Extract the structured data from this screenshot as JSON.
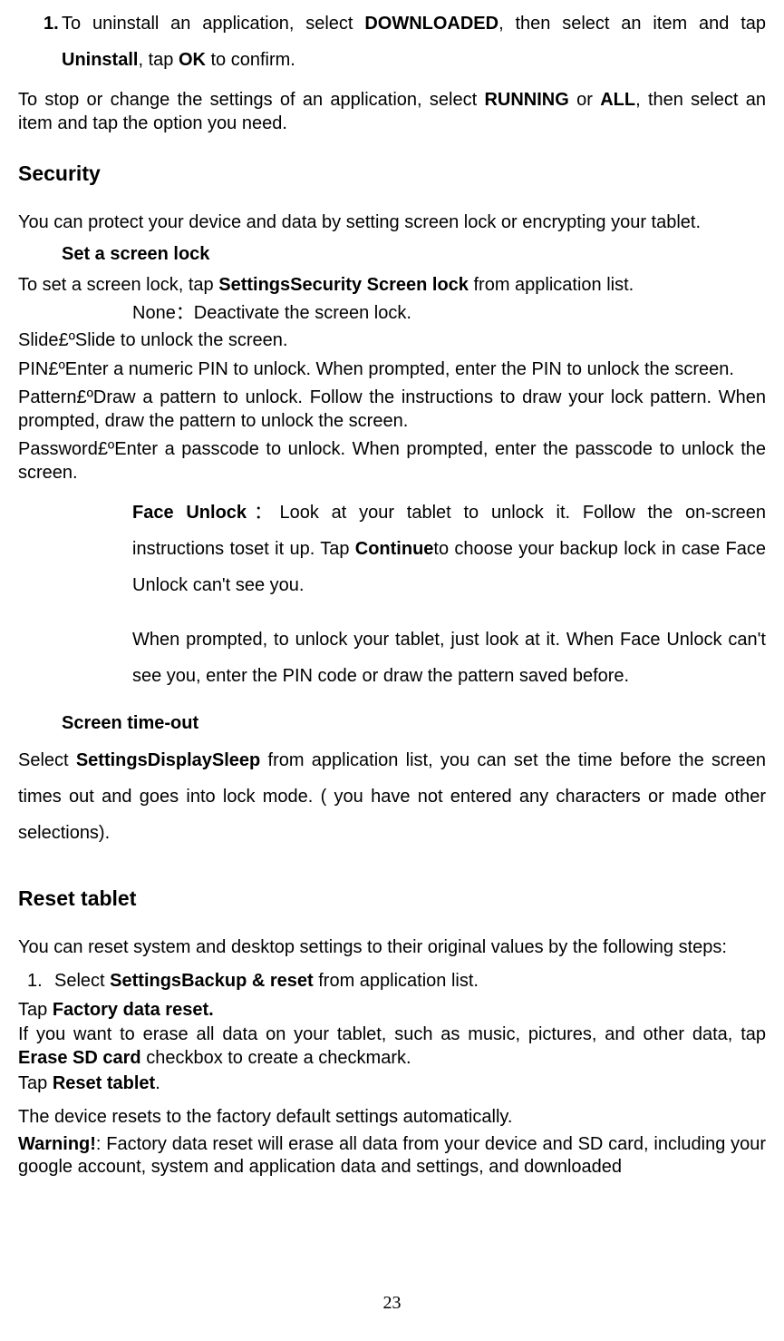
{
  "top_line": {
    "num": "1.",
    "part1": "To uninstall an application, select ",
    "b1": "DOWNLOADED",
    "part2": ", then select an item and tap ",
    "b2": "Uninstall",
    "part3": ", tap ",
    "b3": "OK",
    "part4": " to confirm."
  },
  "stop_change": {
    "p1": "To stop or change the settings of an application, select ",
    "b1": "RUNNING",
    "mid": " or ",
    "b2": "ALL",
    "p2": ", then select an item and tap the option you need."
  },
  "security_heading": "Security",
  "security_intro": "You can protect your device and data by setting screen lock or encrypting your tablet.",
  "set_screen_lock": {
    "marker": "",
    "label": "Set a screen lock",
    "sentence_pre": "To set a screen lock, tap ",
    "settings": "Settings",
    "arrow1": "",
    "security": "Security",
    "arrow2": "",
    "screenlock": " Screen lock",
    "sentence_post": " from application list."
  },
  "none_line": {
    "marker": "",
    "text": "None：Deactivate the screen lock."
  },
  "slide_line": "Slide£ºSlide to unlock the screen.",
  "pin_line": "PIN£ºEnter a numeric PIN to unlock. When prompted, enter the PIN to unlock the screen.",
  "pattern_line": "Pattern£ºDraw a pattern to unlock. Follow the instructions to draw your lock pattern. When prompted, draw the pattern to unlock the screen.",
  "password_line": "Password£ºEnter a passcode to unlock. When prompted, enter the passcode to unlock the screen.",
  "face_unlock": {
    "marker": "",
    "label": "Face Unlock",
    "sep": "：",
    "p1a": "Look at your tablet to unlock it. Follow the on-screen instructions toset it up. Tap ",
    "cont": "Continue",
    "p1b": "to choose your backup lock in case Face Unlock can't see you.",
    "p2": "When prompted, to unlock your tablet, just look at it. When Face Unlock can't see you, enter the PIN code or draw the pattern saved before."
  },
  "screen_timeout": {
    "marker": "",
    "label": "Screen time-out",
    "select_word": "Select ",
    "settings": "Settings",
    "arrow1": "",
    "display": "Display",
    "arrow2": "",
    "sleep": "Sleep",
    "rest": " from application list, you can set the time before the screen times out and goes into lock mode. ( you have not entered any characters or made other selections)."
  },
  "reset_heading": "Reset tablet",
  "reset_intro": "You can reset system and desktop settings to their original values by the following steps:",
  "reset_step1": {
    "num": "1.",
    "pre": "Select ",
    "settings": "Settings",
    "arrow": "",
    "backup": "Backup & reset",
    "post": " from application list."
  },
  "tap_factory_pre": "Tap ",
  "tap_factory_bold": "Factory data reset.",
  "erase_sd": {
    "p1": "If you want to erase all data on your tablet, such as music, pictures, and other data, tap ",
    "b": "Erase SD card",
    "p2": " checkbox to create a checkmark."
  },
  "tap_reset_pre": "Tap ",
  "tap_reset_bold": "Reset tablet",
  "tap_reset_post": ".",
  "auto_reset": "The device resets to the factory default settings automatically.",
  "warning": {
    "b": "Warning!",
    "rest": ": Factory data reset will erase all data from your device and SD card, including your google account, system and application data and settings, and downloaded"
  },
  "page_number": "23"
}
